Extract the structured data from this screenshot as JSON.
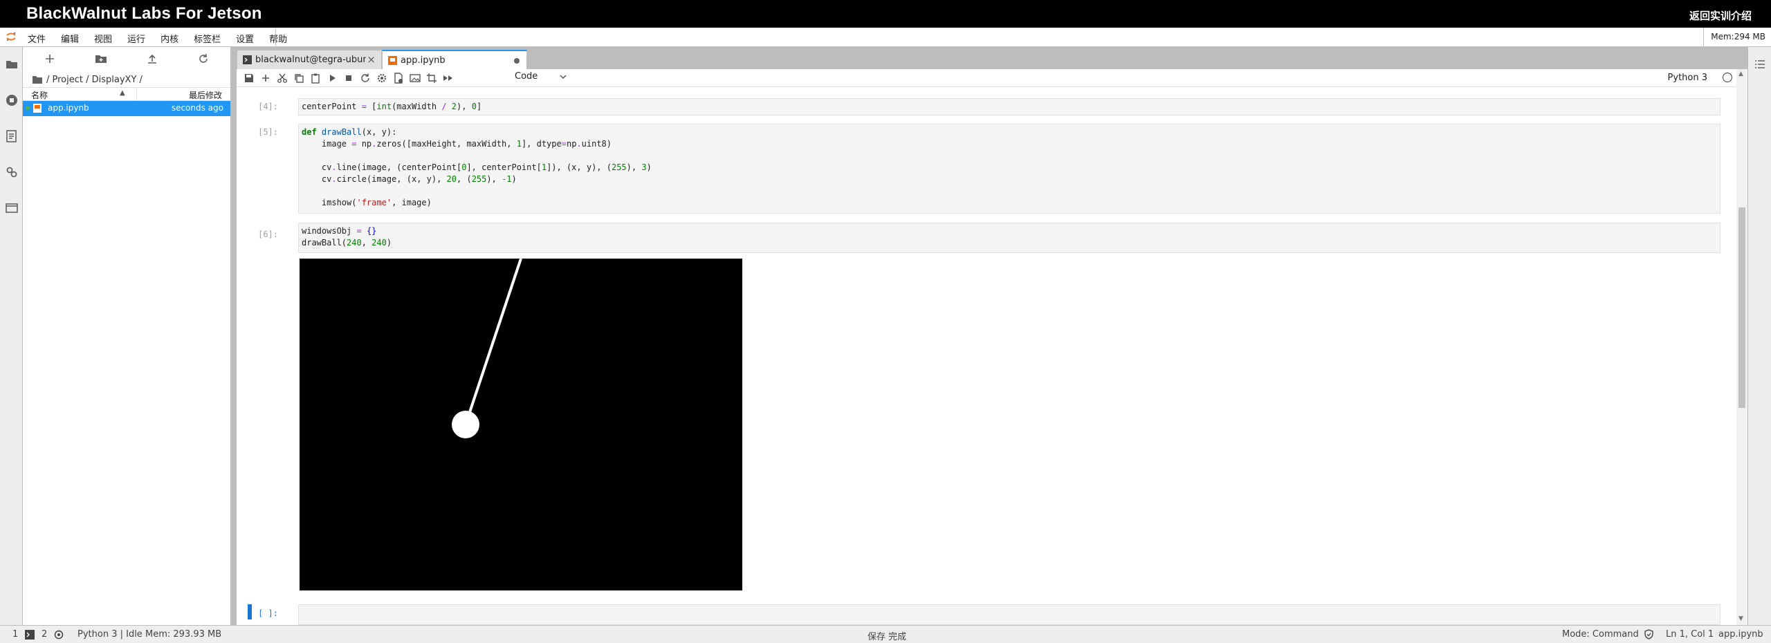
{
  "brand": {
    "title": "BlackWalnut Labs For Jetson",
    "back_link": "返回实训介绍"
  },
  "menu": {
    "items": [
      "文件",
      "编辑",
      "视图",
      "运行",
      "内核",
      "标签栏",
      "设置",
      "帮助"
    ],
    "memory": "Mem:294 MB"
  },
  "filebrowser": {
    "path": "/ Project / DisplayXY /",
    "col_name": "名称",
    "col_modified": "最后修改",
    "files": [
      {
        "name": "app.ipynb",
        "modified": "seconds ago"
      }
    ]
  },
  "tabs": [
    {
      "label": "blackwalnut@tegra-ubuntu:",
      "icon": "terminal-icon"
    },
    {
      "label": "app.ipynb",
      "icon": "notebook-icon"
    }
  ],
  "notebook_toolbar": {
    "cell_type": "Code",
    "kernel": "Python 3"
  },
  "cells": [
    {
      "prompt": "[4]:"
    },
    {
      "prompt": "[5]:"
    },
    {
      "prompt": "[6]:"
    },
    {
      "prompt": "[ ]:"
    }
  ],
  "status": {
    "left_num": "1",
    "terminals": "2",
    "kernel_state": "Python 3 | Idle",
    "memory": "Mem: 293.93 MB",
    "save_state": "保存 完成",
    "mode": "Mode: Command",
    "position": "Ln 1, Col 1",
    "file": "app.ipynb"
  },
  "colors": {
    "accent": "#2196f3",
    "brand_bg": "#000000"
  }
}
